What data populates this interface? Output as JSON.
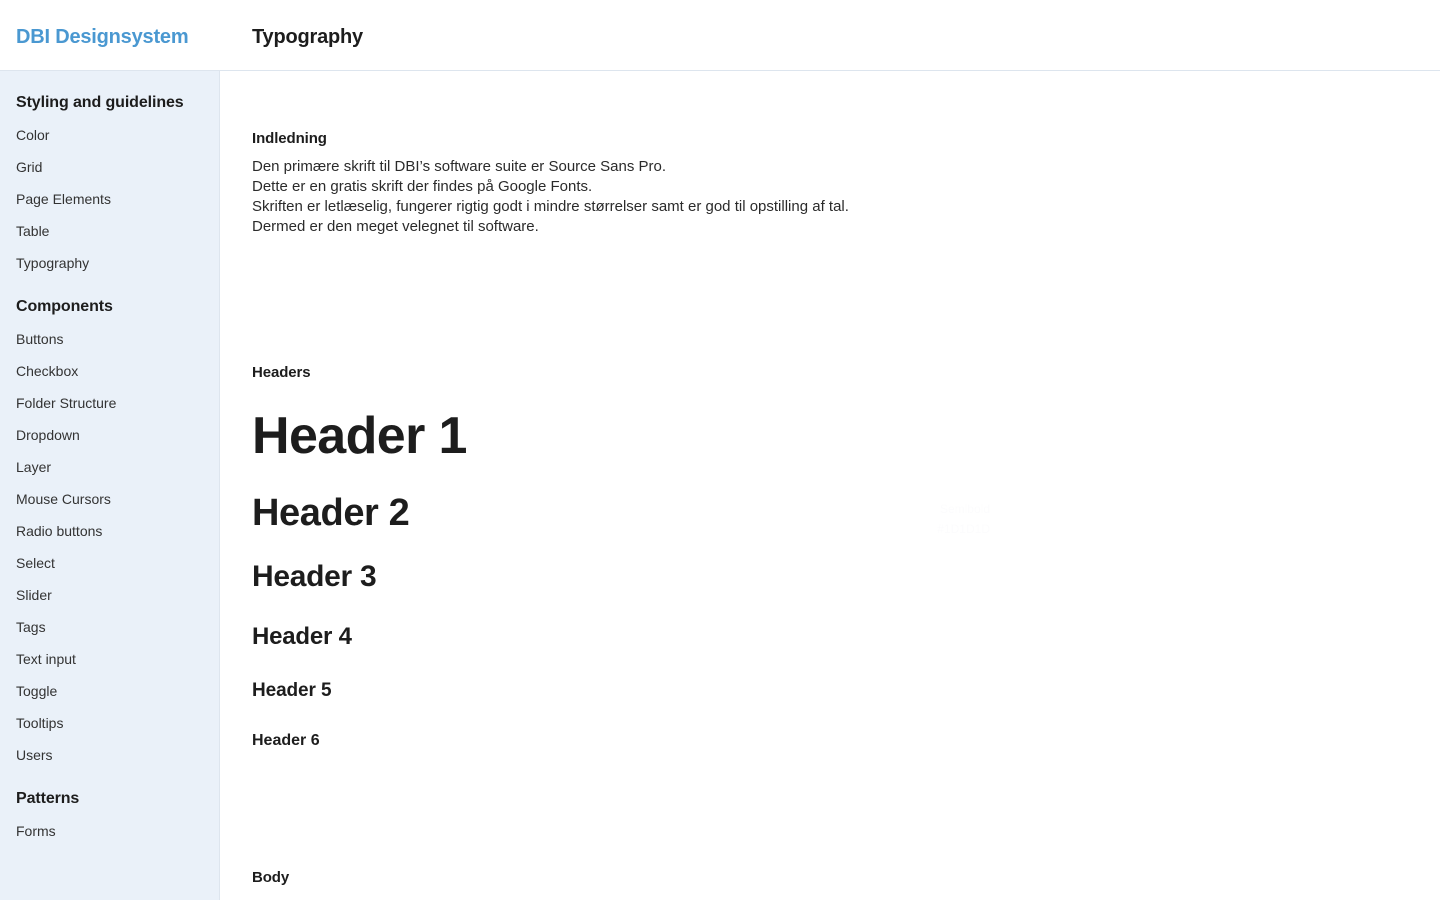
{
  "header": {
    "brand": "DBI Designsystem",
    "page_title": "Typography"
  },
  "colors": {
    "brand_blue": "#4a98d1",
    "sidebar_bg": "#eaf1f9",
    "border": "#dde5ee",
    "text": "#1d1d1d",
    "body_text": "#2b2b2b"
  },
  "sidebar": {
    "groups": [
      {
        "title": "Styling and guidelines",
        "items": [
          {
            "label": "Color"
          },
          {
            "label": "Grid"
          },
          {
            "label": "Page Elements"
          },
          {
            "label": "Table"
          },
          {
            "label": "Typography"
          }
        ]
      },
      {
        "title": "Components",
        "items": [
          {
            "label": "Buttons"
          },
          {
            "label": "Checkbox"
          },
          {
            "label": "Folder Structure"
          },
          {
            "label": "Dropdown"
          },
          {
            "label": "Layer"
          },
          {
            "label": "Mouse Cursors"
          },
          {
            "label": "Radio buttons"
          },
          {
            "label": "Select"
          },
          {
            "label": "Slider"
          },
          {
            "label": "Tags"
          },
          {
            "label": "Text input"
          },
          {
            "label": "Toggle"
          },
          {
            "label": "Tooltips"
          },
          {
            "label": "Users"
          }
        ]
      },
      {
        "title": "Patterns",
        "items": [
          {
            "label": "Forms"
          }
        ]
      }
    ]
  },
  "main": {
    "intro": {
      "heading": "Indledning",
      "lines": [
        "Den primære skrift til DBI’s software suite er Source Sans Pro.",
        "Dette er en gratis skrift der findes på Google Fonts.",
        "Skriften er letlæselig, fungerer rigtig godt i mindre størrelser samt er god til opstilling af tal.",
        "Dermed er den meget velegnet til software."
      ]
    },
    "headers": {
      "heading": "Headers",
      "samples": [
        {
          "label": "Header 1"
        },
        {
          "label": "Header 2"
        },
        {
          "label": "Header 3"
        },
        {
          "label": "Header 4"
        },
        {
          "label": "Header 5"
        },
        {
          "label": "Header 6"
        }
      ]
    },
    "spec_note": {
      "weight": "Semibold",
      "color": "#1D1D1D"
    },
    "body": {
      "heading": "Body"
    }
  }
}
